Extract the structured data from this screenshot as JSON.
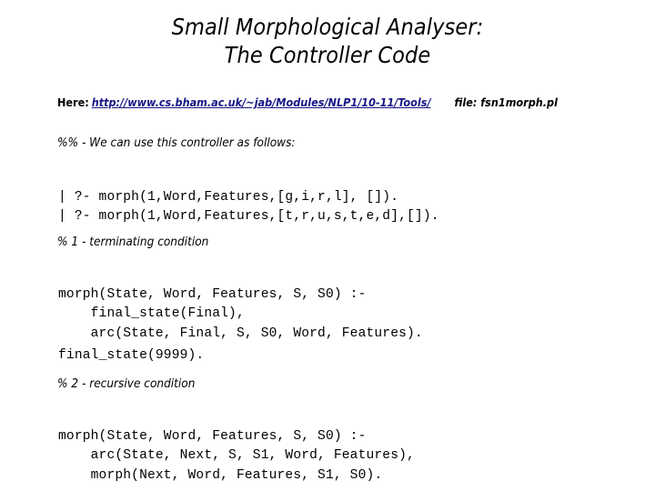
{
  "slide": {
    "background_color": "#ffffff",
    "text_color": "#000000",
    "link_color": "#171787"
  },
  "title": {
    "line1": "Small Morphological Analyser:",
    "line2": "The Controller Code"
  },
  "source": {
    "here_label": "Here:",
    "url": "http://www.cs.bham.ac.uk/~jab/Modules/NLP1/10-11/Tools/",
    "file_label": "file: fsn1morph.pl"
  },
  "comments": {
    "intro": "%% - We can use this controller as follows:",
    "section_one": "% 1 - terminating condition",
    "section_two": "% 2 - recursive condition"
  },
  "code": {
    "queries": "| ?- morph(1,Word,Features,[g,i,r,l], []).\n| ?- morph(1,Word,Features,[t,r,u,s,t,e,d],[]).",
    "rule_terminating": "morph(State, Word, Features, S, S0) :-\n    final_state(Final),\n    arc(State, Final, S, S0, Word, Features).",
    "final_state_fact": "final_state(9999).",
    "rule_recursive": "morph(State, Word, Features, S, S0) :-\n    arc(State, Next, S, S1, Word, Features),\n    morph(Next, Word, Features, S1, S0)."
  }
}
